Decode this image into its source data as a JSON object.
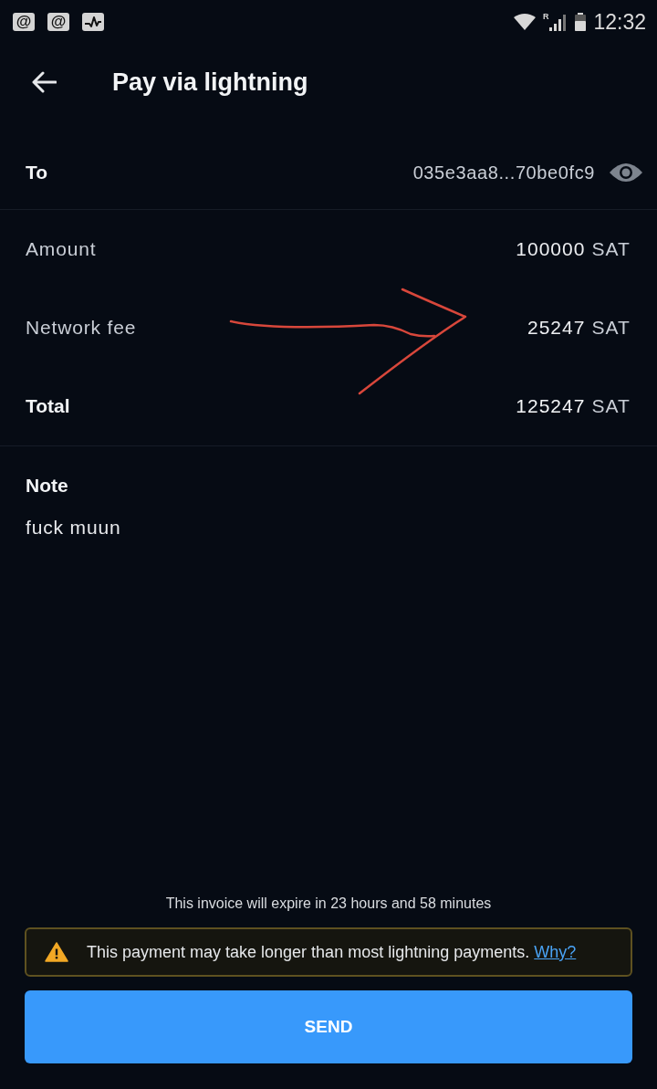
{
  "status_bar": {
    "notifications": [
      {
        "kind": "mention",
        "glyph": "@"
      },
      {
        "kind": "mention",
        "glyph": "@"
      },
      {
        "kind": "activity"
      }
    ],
    "roaming": "R",
    "time": "12:32"
  },
  "header": {
    "title": "Pay via lightning"
  },
  "recipient": {
    "label": "To",
    "value": "035e3aa8...70be0fc9"
  },
  "summary": [
    {
      "label": "Amount",
      "amount": "100000",
      "unit": "SAT",
      "emphasis": false
    },
    {
      "label": "Network fee",
      "amount": "25247",
      "unit": "SAT",
      "emphasis": false
    },
    {
      "label": "Total",
      "amount": "125247",
      "unit": "SAT",
      "emphasis": true
    }
  ],
  "note": {
    "label": "Note",
    "text": "fuck muun"
  },
  "expiry": "This invoice will expire in 23 hours and 58 minutes",
  "warning": {
    "text": "This payment may take longer than most lightning payments.",
    "link": "Why?"
  },
  "send_button": "SEND"
}
